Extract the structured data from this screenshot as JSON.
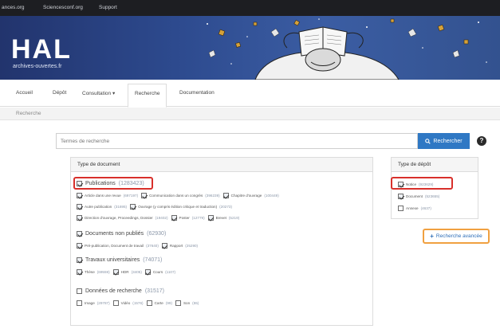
{
  "topbar": {
    "links": [
      "ances.org",
      "Sciencesconf.org",
      "Support"
    ]
  },
  "banner": {
    "logo": "HAL",
    "subtitle": "archives-ouvertes.fr"
  },
  "nav": {
    "tabs": [
      "Accueil",
      "Dépôt",
      "Consultation ▾",
      "Recherche",
      "Documentation"
    ],
    "active": "Recherche"
  },
  "breadcrumb": "Recherche",
  "search": {
    "placeholder": "Termes de recherche",
    "button_label": "Rechercher",
    "help_label": "?"
  },
  "doc_type_panel": {
    "title": "Type de document",
    "groups": [
      {
        "label": "Publications",
        "count": "(1283423)",
        "checked": true,
        "rows": [
          [
            {
              "label": "Article dans une revue",
              "count": "(697197)",
              "checked": true
            },
            {
              "label": "Communication dans un congrès",
              "count": "(396239)",
              "checked": true
            },
            {
              "label": "Chapitre d'ouvrage",
              "count": "(100449)",
              "checked": true
            }
          ],
          [
            {
              "label": "Autre publication",
              "count": "(31695)",
              "checked": true
            },
            {
              "label": "Ouvrage (y compris édition critique et traduction)",
              "count": "(20273)",
              "checked": true
            }
          ],
          [
            {
              "label": "Direction d'ouvrage, Proceedings, Dossier",
              "count": "(19402)",
              "checked": true
            },
            {
              "label": "Poster",
              "count": "(12779)",
              "checked": true
            },
            {
              "label": "Brevet",
              "count": "(5219)",
              "checked": true
            }
          ]
        ]
      },
      {
        "label": "Documents non publiés",
        "count": "(62930)",
        "checked": true,
        "rows": [
          [
            {
              "label": "Pré-publication, Document de travail",
              "count": "(37640)",
              "checked": true
            },
            {
              "label": "Rapport",
              "count": "(25290)",
              "checked": true
            }
          ]
        ]
      },
      {
        "label": "Travaux universitaires",
        "count": "(74071)",
        "checked": true,
        "rows": [
          [
            {
              "label": "Thèse",
              "count": "(69559)",
              "checked": true
            },
            {
              "label": "HDR",
              "count": "(3405)",
              "checked": true
            },
            {
              "label": "Cours",
              "count": "(1107)",
              "checked": true
            }
          ]
        ]
      },
      {
        "label": "Données de recherche",
        "count": "(31517)",
        "checked": false,
        "rows": [
          [
            {
              "label": "Image",
              "count": "(29787)",
              "checked": false
            },
            {
              "label": "Vidéo",
              "count": "(1576)",
              "checked": false
            },
            {
              "label": "Carte",
              "count": "(99)",
              "checked": false
            },
            {
              "label": "Son",
              "count": "(55)",
              "checked": false
            }
          ]
        ]
      }
    ]
  },
  "deposit_type_panel": {
    "title": "Type de dépôt",
    "items": [
      {
        "label": "Notice",
        "count": "(923629)",
        "checked": true
      },
      {
        "label": "Document",
        "count": "(523655)",
        "checked": true
      },
      {
        "label": "Annexe",
        "count": "(4637)",
        "checked": false
      }
    ]
  },
  "advanced_search": {
    "label": "Recherche avancée"
  },
  "colors": {
    "topbar": "#1d1e22",
    "banner": "#2d4a8e",
    "search_button": "#2f78c4",
    "highlight_red": "#d8302b",
    "highlight_orange": "#f0a040"
  }
}
